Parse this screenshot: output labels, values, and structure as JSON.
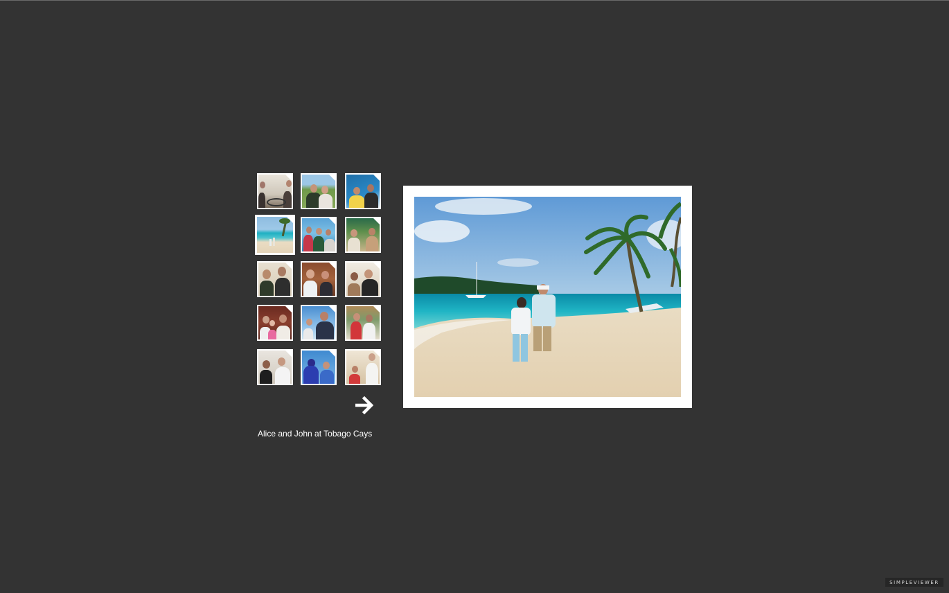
{
  "gallery": {
    "caption": "Alice and John at Tobago Cays",
    "brand": "SIMPLEVIEWER",
    "next_icon": "arrow-right-icon",
    "selected_index": 3,
    "thumbnails": [
      {
        "label": "",
        "scene": "boat-helm"
      },
      {
        "label": "",
        "scene": "couple-field"
      },
      {
        "label": "",
        "scene": "boat-deck-blue"
      },
      {
        "label": "",
        "scene": "beach-palm"
      },
      {
        "label": "",
        "scene": "boat-group"
      },
      {
        "label": "",
        "scene": "market-table"
      },
      {
        "label": "",
        "scene": "couple-indoor"
      },
      {
        "label": "",
        "scene": "couple-cabin"
      },
      {
        "label": "",
        "scene": "couple-cabin-2"
      },
      {
        "label": "",
        "scene": "family-cabin"
      },
      {
        "label": "",
        "scene": "sailing-sky"
      },
      {
        "label": "",
        "scene": "couple-harbor"
      },
      {
        "label": "",
        "scene": "couple-marina"
      },
      {
        "label": "",
        "scene": "jackets-blue"
      },
      {
        "label": "",
        "scene": "dinner-boat"
      }
    ]
  },
  "colors": {
    "background": "#333333",
    "frame": "#ffffff",
    "sea": "#1fb4c4",
    "sky": "#7fb2dc",
    "sand": "#eadcc3"
  }
}
